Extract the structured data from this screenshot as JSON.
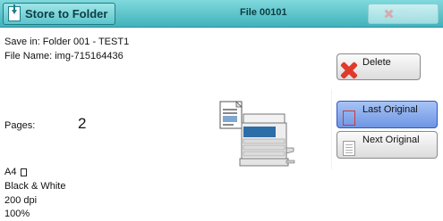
{
  "header": {
    "title": "Store to Folder",
    "file_title": "File 00101",
    "close_label": "Close"
  },
  "info": {
    "save_in": "Save in: Folder 001 - TEST1",
    "file_name": "File Name: img-715164436",
    "pages_label": "Pages:",
    "pages_value": "2",
    "paper_size": "A4",
    "color_mode": "Black & White",
    "resolution": "200 dpi",
    "zoom": "100%"
  },
  "actions": {
    "delete_label": "Delete",
    "last_original_label": "Last Original",
    "next_original_label": "Next Original"
  },
  "colors": {
    "titlebar": "#42b2bb",
    "selected_button": "#6f95e4",
    "delete_icon": "#e03a2a"
  },
  "icons": {
    "title": "store-to-folder-icon",
    "close": "close-icon",
    "delete": "delete-x-icon",
    "last_original": "document-icon",
    "next_original": "document-icon",
    "paper": "portrait-page-icon"
  }
}
